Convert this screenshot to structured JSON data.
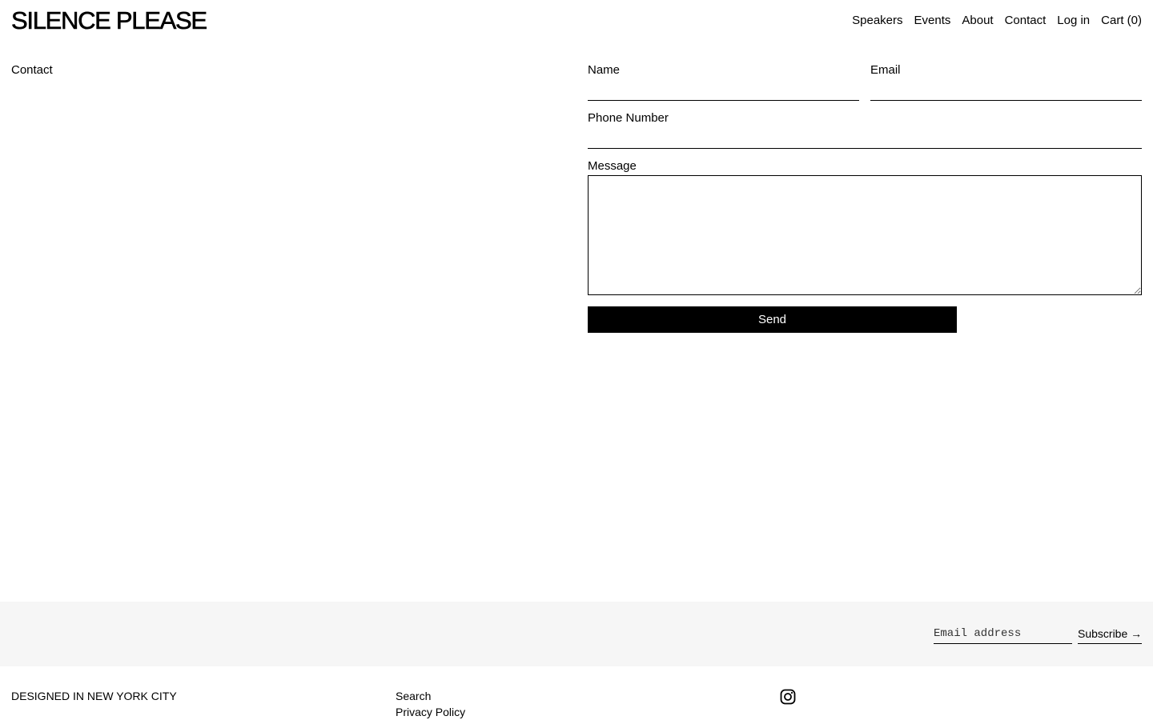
{
  "header": {
    "logo": "SILENCE PLEASE",
    "nav": [
      {
        "label": "Speakers"
      },
      {
        "label": "Events"
      },
      {
        "label": "About"
      },
      {
        "label": "Contact"
      },
      {
        "label": "Log in"
      },
      {
        "label": "Cart (0)"
      }
    ]
  },
  "page": {
    "title": "Contact"
  },
  "form": {
    "name_label": "Name",
    "name_value": "",
    "email_label": "Email",
    "email_value": "",
    "phone_label": "Phone Number",
    "phone_value": "",
    "message_label": "Message",
    "message_value": "",
    "send_label": "Send"
  },
  "newsletter": {
    "email_placeholder": "Email address",
    "subscribe_label": "Subscribe →"
  },
  "footer": {
    "note": "DESIGNED IN NEW YORK CITY",
    "links": [
      {
        "label": "Search"
      },
      {
        "label": "Privacy Policy"
      }
    ],
    "social_icon": "instagram-icon"
  }
}
